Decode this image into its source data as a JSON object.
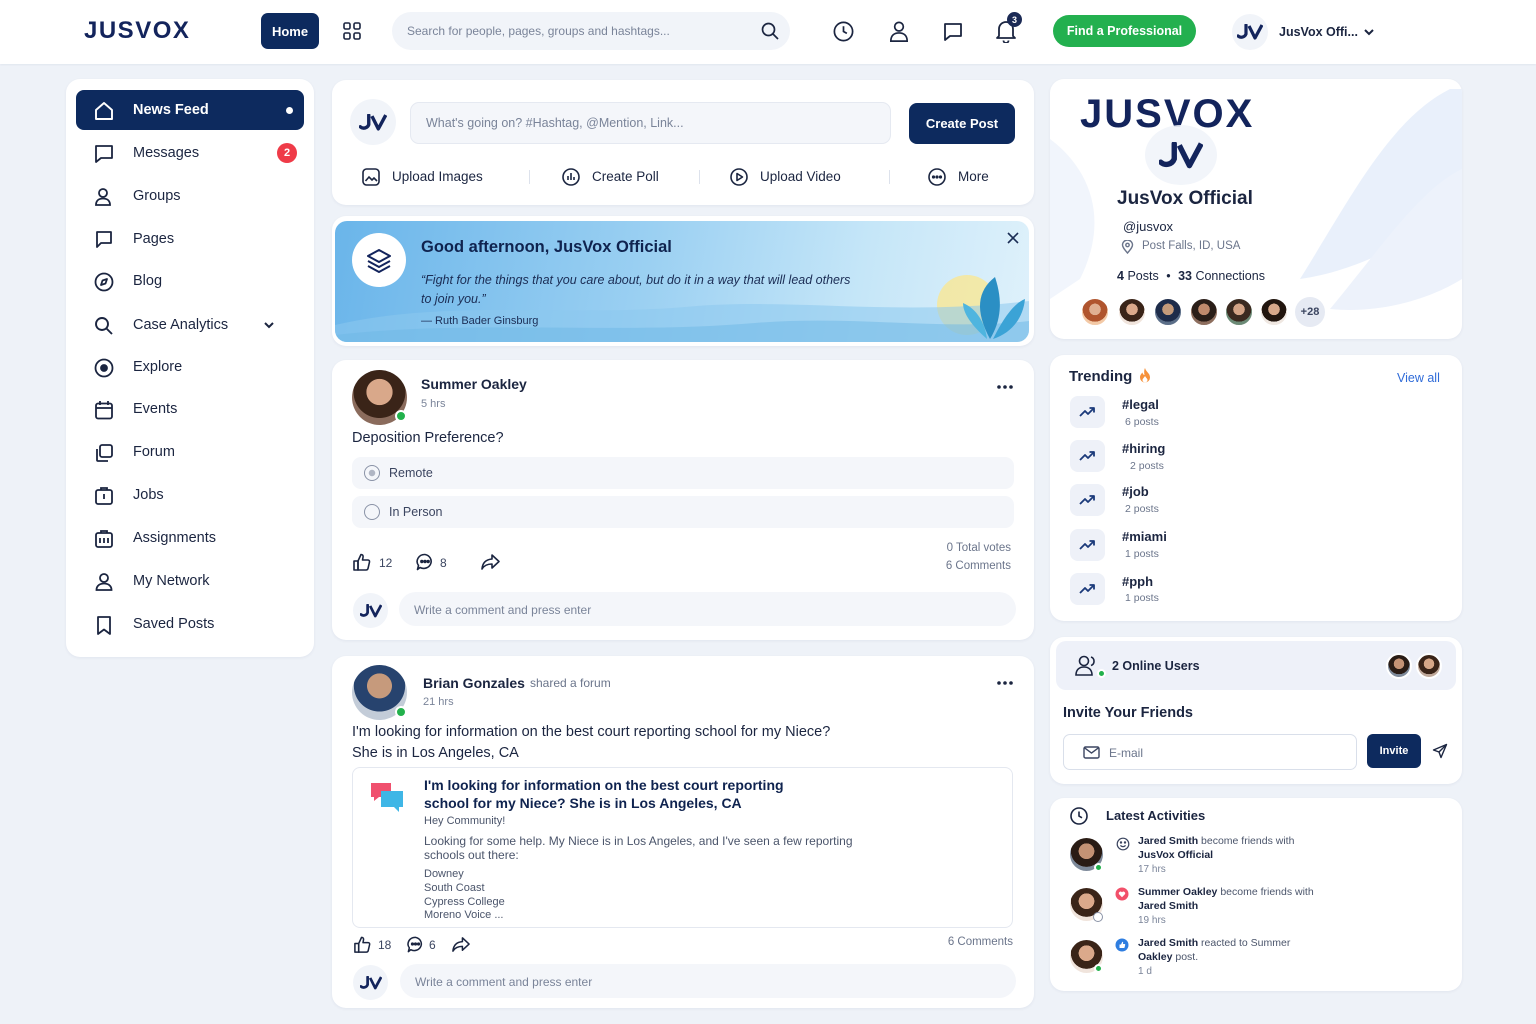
{
  "header": {
    "logo": "JUSVOX",
    "home_label": "Home",
    "search_placeholder": "Search for people, pages, groups and hashtags...",
    "notification_count": "3",
    "find_professional": "Find a Professional",
    "account_name": "JusVox Offi..."
  },
  "sidebar": {
    "items": [
      {
        "label": "News Feed",
        "icon": "home-icon"
      },
      {
        "label": "Messages",
        "icon": "message-icon",
        "badge": "2"
      },
      {
        "label": "Groups",
        "icon": "user-icon"
      },
      {
        "label": "Pages",
        "icon": "page-icon"
      },
      {
        "label": "Blog",
        "icon": "compass-icon"
      },
      {
        "label": "Case Analytics",
        "icon": "search-icon"
      },
      {
        "label": "Explore",
        "icon": "explore-icon"
      },
      {
        "label": "Events",
        "icon": "calendar-icon"
      },
      {
        "label": "Forum",
        "icon": "forum-icon"
      },
      {
        "label": "Jobs",
        "icon": "briefcase-icon"
      },
      {
        "label": "Assignments",
        "icon": "assignment-icon"
      },
      {
        "label": "My Network",
        "icon": "network-icon"
      },
      {
        "label": "Saved Posts",
        "icon": "bookmark-icon"
      }
    ]
  },
  "composer": {
    "placeholder": "What's going on? #Hashtag, @Mention, Link...",
    "create_label": "Create Post",
    "actions": [
      "Upload Images",
      "Create Poll",
      "Upload Video",
      "More"
    ]
  },
  "greeting": {
    "title": "Good afternoon, JusVox Official",
    "quote": "“Fight for the things that you care about, but do it in a way that will lead others to join you.”",
    "author": "— Ruth Bader Ginsburg"
  },
  "post1": {
    "author": "Summer Oakley",
    "time": "5 hrs",
    "question": "Deposition Preference?",
    "options": [
      "Remote",
      "In Person"
    ],
    "likes": "12",
    "comments": "8",
    "total_votes": "0 Total votes",
    "comment_count": "6 Comments",
    "comment_placeholder": "Write a comment and press enter"
  },
  "post2": {
    "author": "Brian Gonzales",
    "action": "shared a forum",
    "time": "21 hrs",
    "text_line1": "I'm looking for information on the best court reporting school for my Niece?",
    "text_line2": "She is in Los Angeles, CA",
    "forum_title": "I'm looking for information on the best court reporting school for my Niece? She is in Los Angeles, CA",
    "forum_greeting": "Hey Community!",
    "forum_body": "Looking for some help. My Niece is in Los Angeles, and I've seen a few reporting schools out there:",
    "forum_list": [
      "Downey",
      "South Coast",
      "Cypress College",
      "Moreno Voice ..."
    ],
    "likes": "18",
    "comments": "6",
    "comment_count": "6 Comments",
    "comment_placeholder": "Write a comment and press enter"
  },
  "profile": {
    "brand": "JUSVOX",
    "name": "JusVox Official",
    "handle": "@jusvox",
    "location": "Post Falls, ID, USA",
    "posts": "4",
    "posts_label": "Posts",
    "connections": "33",
    "connections_label": "Connections",
    "more_count": "+28"
  },
  "trending": {
    "title": "Trending",
    "view_all": "View all",
    "items": [
      {
        "tag": "#legal",
        "count": "6 posts"
      },
      {
        "tag": "#hiring",
        "count": "2 posts"
      },
      {
        "tag": "#job",
        "count": "2 posts"
      },
      {
        "tag": "#miami",
        "count": "1 posts"
      },
      {
        "tag": "#pph",
        "count": "1 posts"
      }
    ]
  },
  "online": {
    "label": "2 Online Users"
  },
  "invite": {
    "title": "Invite Your Friends",
    "placeholder": "E-mail",
    "button": "Invite"
  },
  "activities": {
    "title": "Latest Activities",
    "items": [
      {
        "actor": "Jared Smith",
        "verb": "become friends with",
        "target": "JusVox Official",
        "time": "17 hrs"
      },
      {
        "actor": "Summer Oakley",
        "verb": "become friends with",
        "target": "Jared Smith",
        "time": "19 hrs"
      },
      {
        "actor": "Jared Smith",
        "verb": "reacted to Summer",
        "target": "Oakley",
        "suffix": "post.",
        "time": "1 d"
      }
    ]
  },
  "colors": {
    "primary": "#0d2a5e",
    "green": "#23b04f",
    "badge_red": "#ef3b48",
    "accent_blue": "#2f6bd8"
  }
}
